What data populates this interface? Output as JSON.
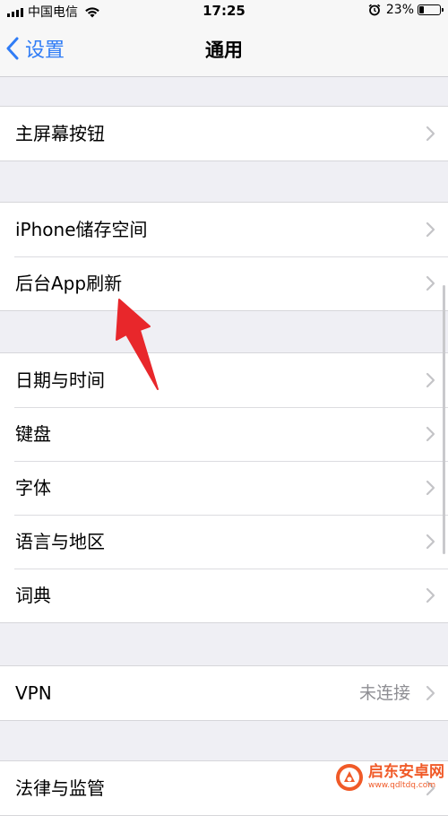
{
  "status_bar": {
    "carrier": "中国电信",
    "time": "17:25",
    "battery": "23%"
  },
  "nav": {
    "back_label": "设置",
    "title": "通用"
  },
  "groups": [
    {
      "rows": [
        {
          "label": "主屏幕按钮"
        }
      ]
    },
    {
      "rows": [
        {
          "label": "iPhone储存空间"
        },
        {
          "label": "后台App刷新"
        }
      ]
    },
    {
      "rows": [
        {
          "label": "日期与时间"
        },
        {
          "label": "键盘"
        },
        {
          "label": "字体"
        },
        {
          "label": "语言与地区"
        },
        {
          "label": "词典"
        }
      ]
    },
    {
      "rows": [
        {
          "label": "VPN",
          "value": "未连接"
        }
      ]
    },
    {
      "rows": [
        {
          "label": "法律与监管"
        }
      ]
    }
  ],
  "watermark": {
    "name": "启东安卓网",
    "url": "www.qdltdq.com"
  },
  "colors": {
    "accent": "#2f7cf6",
    "annotation_arrow": "#e8272b",
    "background": "#efeff4",
    "watermark": "#f05a28"
  },
  "icons": [
    "chevron-left-icon",
    "chevron-right-icon",
    "wifi-icon",
    "alarm-icon",
    "battery-icon",
    "signal-icon"
  ]
}
